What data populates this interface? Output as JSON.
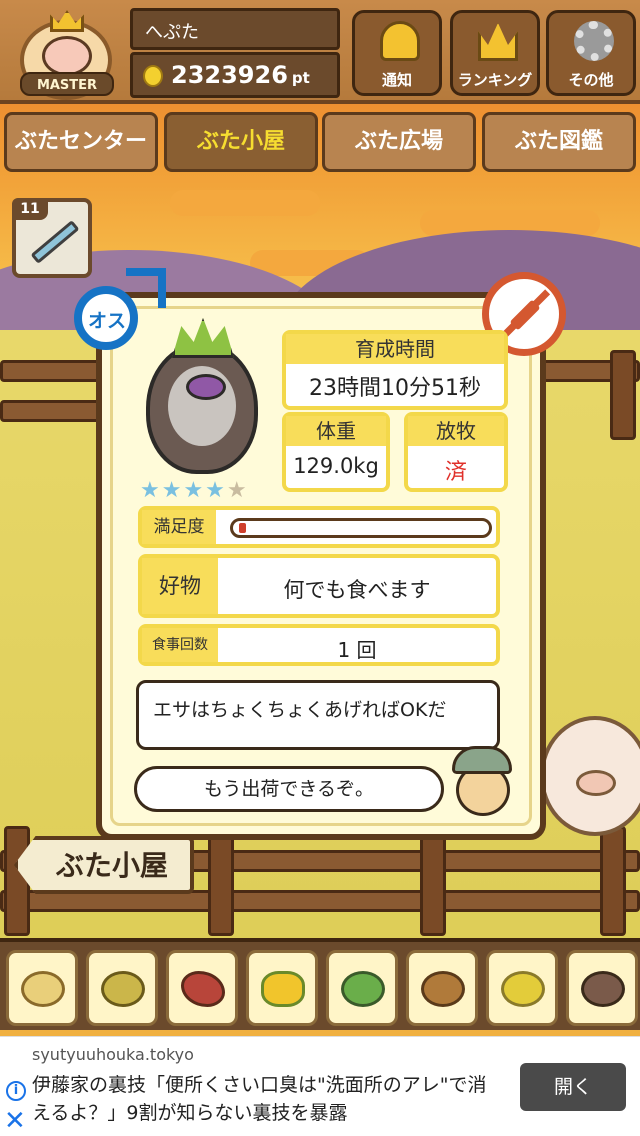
{
  "header": {
    "avatar_label": "MASTER",
    "username": "へぷた",
    "points_value": "2323926",
    "points_unit": "pt",
    "buttons": [
      {
        "label": "通知",
        "icon": "bell-icon"
      },
      {
        "label": "ランキング",
        "icon": "crown-icon"
      },
      {
        "label": "その他",
        "icon": "gear-icon"
      }
    ]
  },
  "tabs": [
    {
      "label": "ぶたセンター"
    },
    {
      "label": "ぶた小屋"
    },
    {
      "label": "ぶた広場"
    },
    {
      "label": "ぶた図鑑"
    }
  ],
  "item_badge": {
    "count": "11",
    "icon": "syringe-icon"
  },
  "pig_card": {
    "sex_label": "オス",
    "rating": {
      "filled": 4,
      "total": 5
    },
    "growth_time_label": "育成時間",
    "growth_time_value": "23時間10分51秒",
    "weight_label": "体重",
    "weight_value": "129.0kg",
    "graze_label": "放牧",
    "graze_value": "済",
    "satisfaction_label": "満足度",
    "satisfaction_level": 0.03,
    "favorite_label": "好物",
    "favorite_value": "何でも食べます",
    "meals_label": "食事回数",
    "meals_value": "1 回",
    "advice_line1": "エサはちょくちょくあげればOKだ",
    "advice_line2": "もう出荷できるぞ。"
  },
  "shed_sign": "ぶた小屋",
  "foods": [
    {
      "icon": "soybeans-icon"
    },
    {
      "icon": "mixed-grain-icon"
    },
    {
      "icon": "sweet-potato-icon"
    },
    {
      "icon": "corn-icon"
    },
    {
      "icon": "herb-nuts-icon"
    },
    {
      "icon": "acorn-icon"
    },
    {
      "icon": "grain-plate-icon"
    },
    {
      "icon": "meatball-plate-icon"
    }
  ],
  "ad": {
    "domain": "syutyuuhouka.tokyo",
    "text": "伊藤家の裏技「便所くさい口臭は\"洗面所のアレ\"で消えるよ？」9割が知らない裏技を暴露",
    "open_label": "開く"
  },
  "colors": {
    "accent_yellow": "#f6dd30",
    "wood_dark": "#5b3a1c",
    "male_blue": "#1673c5",
    "no_medicine_red": "#d45830",
    "graze_done_red": "#e0302a"
  }
}
